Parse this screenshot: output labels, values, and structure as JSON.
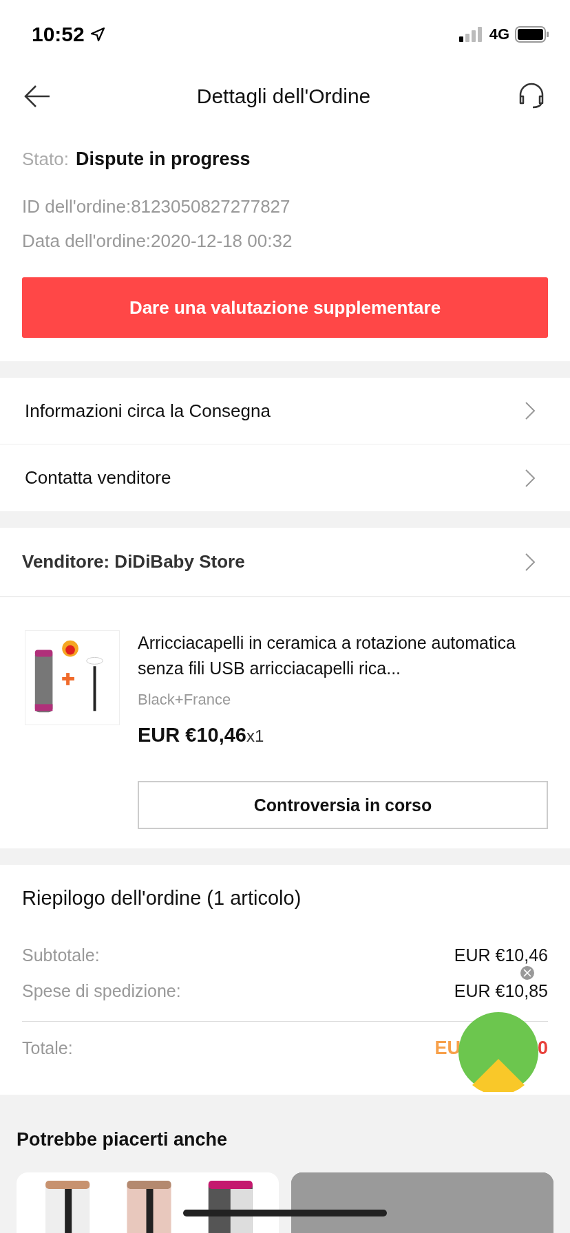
{
  "status_bar": {
    "time": "10:52",
    "network": "4G"
  },
  "header": {
    "title": "Dettagli dell'Ordine"
  },
  "order": {
    "status_label": "Stato:",
    "status": "Dispute in progress",
    "id": "ID dell'ordine:8123050827277827",
    "date": "Data dell'ordine:2020-12-18 00:32",
    "action": "Dare una valutazione supplementare"
  },
  "links": [
    {
      "label": "Informazioni circa la Consegna"
    },
    {
      "label": "Contatta venditore"
    }
  ],
  "seller": {
    "label": "Venditore: DiDiBaby Store"
  },
  "product": {
    "kind": "picture",
    "title": "Arricciacapelli in ceramica a rotazione automatica senza fili USB arricciacapelli rica...",
    "variant": "Black+France",
    "price": "EUR €10,46",
    "quantity": "x1",
    "action": "Controversia in corso"
  },
  "summary": {
    "title": "Riepilogo dell'ordine (1 articolo)",
    "rows": [
      {
        "label": "Subtotale:",
        "value": "EUR €10,46"
      },
      {
        "label": "Spese di spedizione:",
        "value": "EUR €10,85"
      }
    ],
    "total_label": "Totale:",
    "total_value_start": "EU",
    "total_value_end": "0"
  },
  "recommendations": {
    "title": "Potrebbe piacerti anche"
  }
}
